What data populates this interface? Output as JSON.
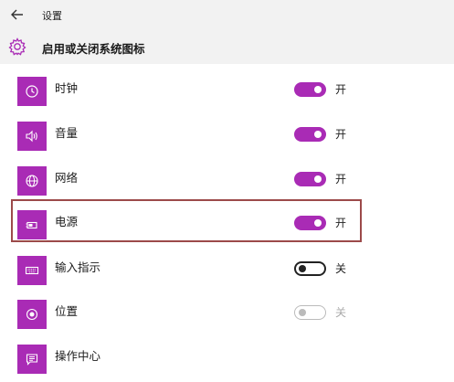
{
  "window": {
    "title": "设置"
  },
  "header": {
    "title": "启用或关闭系统图标"
  },
  "items": [
    {
      "label": "时钟",
      "icon": "clock-icon",
      "state": "on",
      "state_label": "开"
    },
    {
      "label": "音量",
      "icon": "volume-icon",
      "state": "on",
      "state_label": "开"
    },
    {
      "label": "网络",
      "icon": "globe-icon",
      "state": "on",
      "state_label": "开"
    },
    {
      "label": "电源",
      "icon": "battery-icon",
      "state": "on",
      "state_label": "开"
    },
    {
      "label": "输入指示",
      "icon": "keyboard-icon",
      "state": "off",
      "state_label": "关"
    },
    {
      "label": "位置",
      "icon": "location-icon",
      "state": "disabled",
      "state_label": "关"
    },
    {
      "label": "操作中心",
      "icon": "action-center-icon",
      "state": "none",
      "state_label": ""
    }
  ],
  "colors": {
    "accent": "#a92bb5",
    "highlight_border": "#9c4a4a"
  }
}
